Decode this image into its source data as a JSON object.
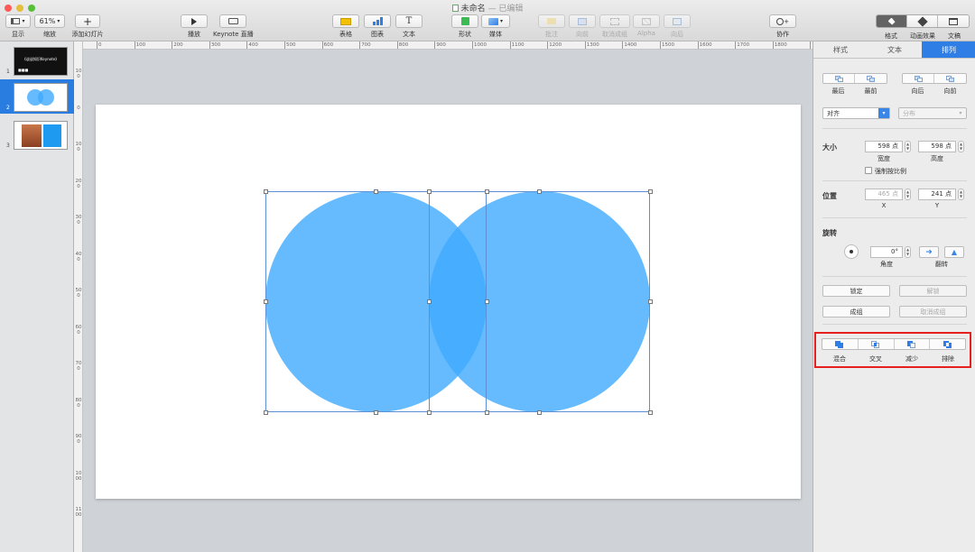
{
  "window": {
    "title": "未命名",
    "status": "— 已编辑",
    "traffic_lights": [
      "#fc5b57",
      "#e5bf3c",
      "#57c038"
    ]
  },
  "toolbar": {
    "view": {
      "label": "显示"
    },
    "zoom": {
      "value": "61%",
      "label": "缩放"
    },
    "add_slide": {
      "label": "添加幻灯片"
    },
    "play": {
      "label": "播放"
    },
    "keynote_live": {
      "button": "Keynote",
      "label": "Keynote 直播"
    },
    "table": {
      "label": "表格"
    },
    "chart": {
      "label": "图表"
    },
    "text": {
      "label": "文本"
    },
    "shape": {
      "label": "形状"
    },
    "media": {
      "label": "媒体"
    },
    "comment": {
      "label": "批注"
    },
    "front": {
      "label": "向前"
    },
    "ungroup": {
      "label": "取消成组"
    },
    "alpha": {
      "label": "Alpha"
    },
    "back": {
      "label": "向后"
    },
    "collaborate": {
      "label": "协作"
    },
    "format": {
      "label": "格式"
    },
    "animate": {
      "label": "动画效果"
    },
    "document": {
      "label": "文稿"
    }
  },
  "navigator": {
    "slides": [
      {
        "number": "1",
        "title": "《谈谈知识Keynote》"
      },
      {
        "number": "2"
      },
      {
        "number": "3"
      }
    ],
    "selected": 2
  },
  "ruler": {
    "top": [
      "0",
      "100",
      "200",
      "300",
      "400",
      "500",
      "600",
      "700",
      "800",
      "900",
      "1000",
      "1100",
      "1200",
      "1300",
      "1400",
      "1500",
      "1600",
      "1700",
      "1800",
      "1900"
    ],
    "left": [
      "100",
      "0",
      "100",
      "200",
      "300",
      "400",
      "500",
      "600",
      "700",
      "800",
      "900",
      "1000",
      "1100"
    ]
  },
  "inspector": {
    "tabs": [
      "样式",
      "文本",
      "排列"
    ],
    "active_tab": "排列",
    "order": {
      "back_most": "最后",
      "front_most": "最前",
      "backward": "向后",
      "forward": "向前"
    },
    "align": {
      "value": "对齐"
    },
    "distribute": {
      "value": "分布"
    },
    "size": {
      "title": "大小",
      "width": "598 点",
      "width_label": "宽度",
      "height": "598 点",
      "height_label": "高度",
      "constrain": "强制按比例"
    },
    "position": {
      "title": "位置",
      "x": "465 点",
      "x_label": "X",
      "y": "241 点",
      "y_label": "Y"
    },
    "rotate": {
      "title": "旋转",
      "angle": "0°",
      "angle_label": "角度",
      "flip_label": "翻转"
    },
    "lock": "锁定",
    "unlock": "解锁",
    "group": "成组",
    "ungroup": "取消成组",
    "boolean": {
      "union": "混合",
      "intersect": "交叉",
      "subtract": "减少",
      "exclude": "排除"
    }
  },
  "colors": {
    "circle_fill": "#40aaff",
    "accent": "#2f7ee6",
    "highlight": "#e5201f"
  }
}
